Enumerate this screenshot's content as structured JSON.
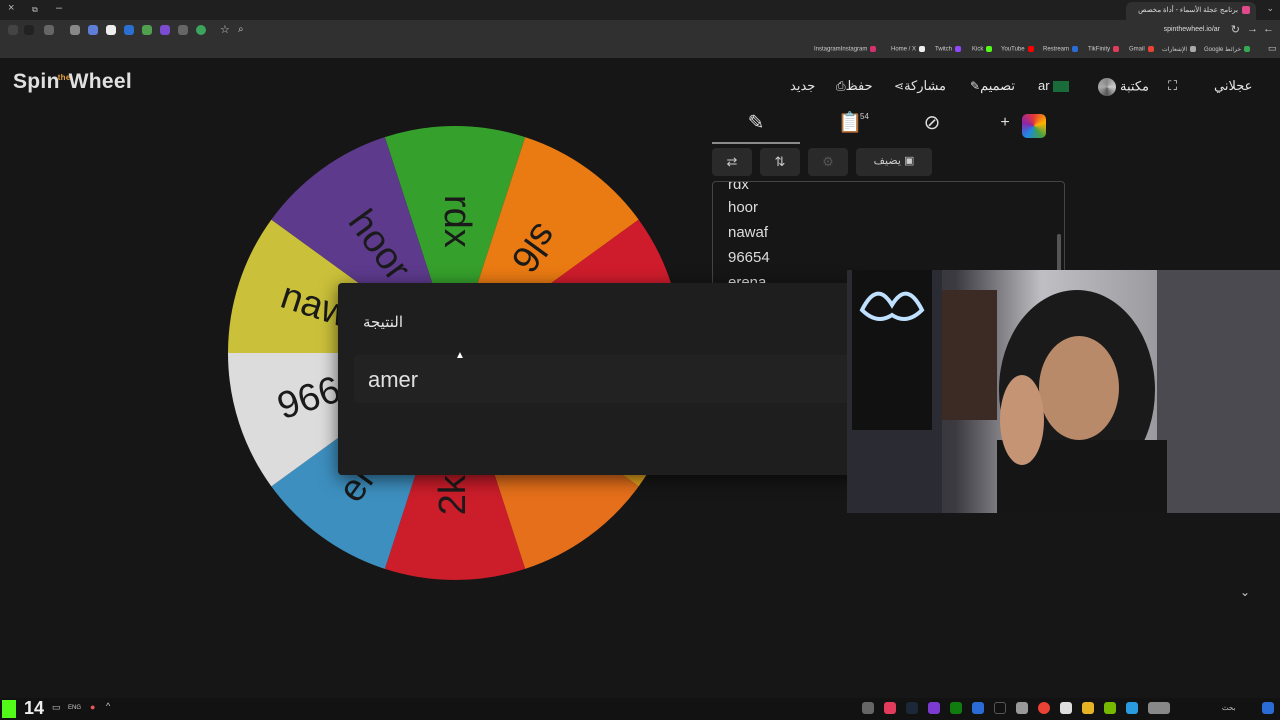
{
  "browser": {
    "active_tab_title": "برنامج عجلة الأسماء - أداة مخصص",
    "url": "spinthewheel.io/ar",
    "bookmarks": [
      "Instagram",
      "Instagram",
      "Home / X",
      "Twitch",
      "Kick",
      "YouTube",
      "Restream",
      "TikFinity",
      "Gmail",
      "الإشعارات",
      "Google خرائط"
    ]
  },
  "header": {
    "logo_left": "Spin",
    "logo_mid": "the",
    "logo_right": "Wheel",
    "new_label": "جديد",
    "save_label": "حفظ",
    "share_label": "مشاركة",
    "design_label": "تصميم",
    "lang_label": "ar",
    "library_label": "مكتبة",
    "user_label": "عجلاني"
  },
  "wheel": {
    "segments": [
      {
        "label": "rdx",
        "color": "#35a02c"
      },
      {
        "label": "sl6",
        "color": "#ea7a12"
      },
      {
        "label": "",
        "color": "#cf1c2c"
      },
      {
        "label": "",
        "color": "#e6a61d"
      },
      {
        "label": "",
        "color": "#e56f1a"
      },
      {
        "label": "2kri",
        "color": "#cb1d2a"
      },
      {
        "label": "erena",
        "color": "#3d8fbf"
      },
      {
        "label": "96654",
        "color": "#dcdcdc"
      },
      {
        "label": "nawaf",
        "color": "#cbc03a"
      },
      {
        "label": "hoor",
        "color": "#5d3a8c"
      }
    ]
  },
  "panel": {
    "results_count": "54",
    "toolbar": {
      "add_image_label": "يضيف"
    },
    "entries": [
      "rdx",
      "hoor",
      "nawaf",
      "96654",
      "erena"
    ]
  },
  "dialog": {
    "title": "النتيجة",
    "result": "amer"
  },
  "taskbar": {
    "clock": "14",
    "lang": "ENG",
    "search": "بحث"
  }
}
